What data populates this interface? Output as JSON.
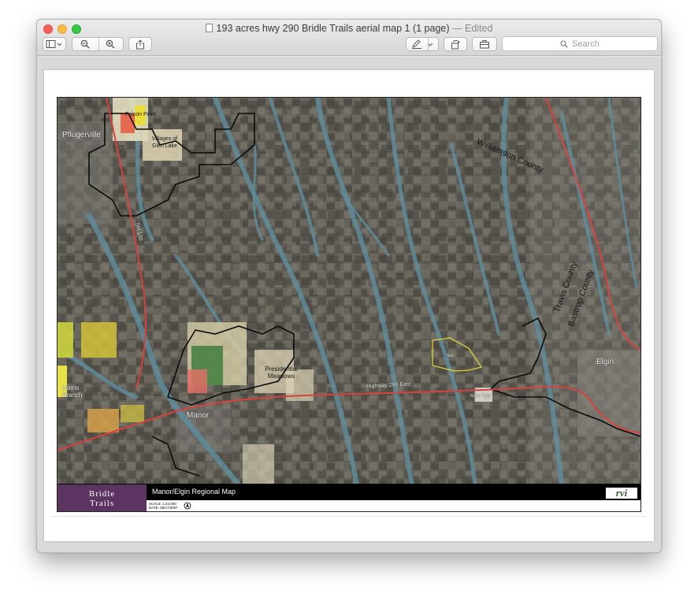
{
  "window": {
    "title": "193 acres hwy 290 Bridle Trails aerial map 1 (1 page)",
    "title_suffix": "— Edited"
  },
  "toolbar": {
    "search_placeholder": "Search",
    "icons": [
      "sidebar-icon",
      "chevron-down-icon",
      "zoom-out-icon",
      "zoom-in-icon",
      "share-icon",
      "pen-markup-icon",
      "chevron-down-icon",
      "rotate-icon",
      "toolbox-icon",
      "search-icon"
    ]
  },
  "map": {
    "labels": {
      "pflugerville": "Pflugerville",
      "falcon_point": "Falcon Point",
      "villages_glen_lake": "Villages of Glen Lake",
      "williamson_county": "Williamson County",
      "travis_county": "Travis County",
      "bastrop_county": "Bastrop County",
      "sh130": "SH 130",
      "highway_290": "Highway 290 East",
      "presidential_meadows": "Presidential Meadows",
      "harris_branch": "Harris Branch",
      "manor": "Manor",
      "elgin": "Elgin",
      "bridle_trails": "Bridle Trails",
      "site": "Site"
    },
    "footer": {
      "brand_line1": "Bridle",
      "brand_line2": "Trails",
      "title": "Manor/Elgin Regional Map",
      "scale": "SCALE: 1:24,000",
      "date": "DATE: 08/17/2007",
      "logo": "rvi"
    },
    "colors": {
      "aerial": "#5c5a52",
      "creeks": "#5f8ea0",
      "highway": "#d7423f",
      "boundary": "#0b0b0b",
      "site_outline": "#e2d43a",
      "brand": "#5b3462"
    }
  }
}
